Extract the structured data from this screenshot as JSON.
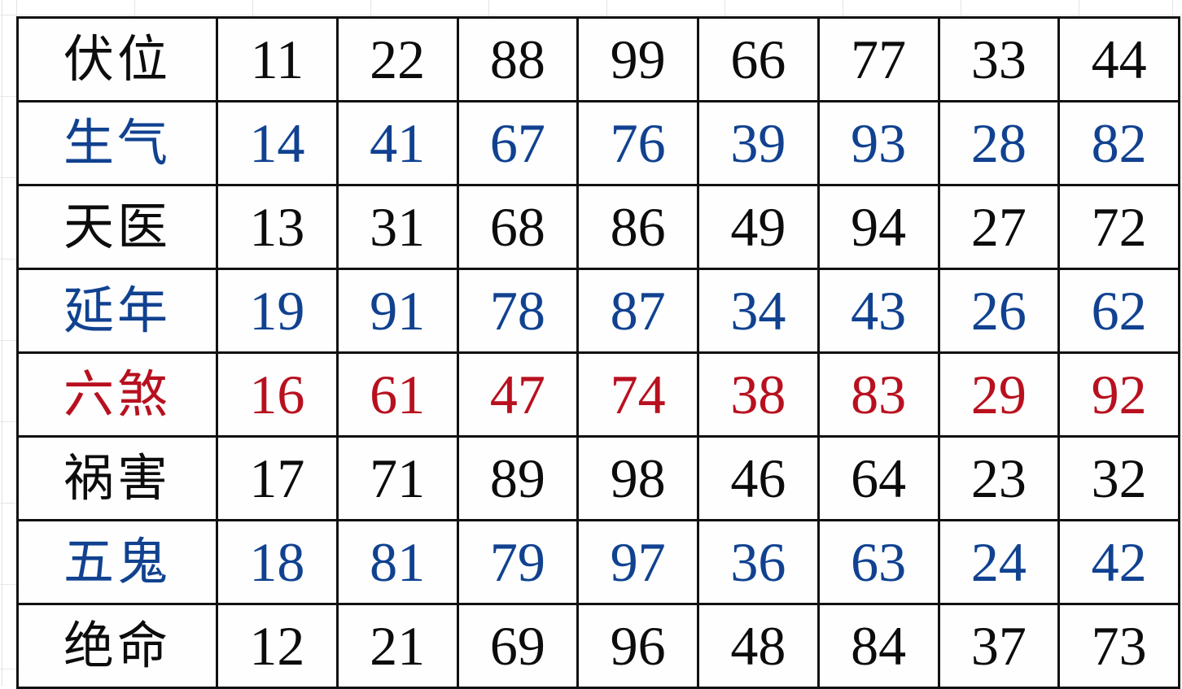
{
  "document": {
    "kind": "bagua-number-chart",
    "title": "伏位 生气 天医 延年 六煞 祸害 五鬼 绝命 数字表"
  },
  "colors": {
    "black": "#0c0c0c",
    "blue": "#11418f",
    "red": "#b8101f",
    "border": "#111111",
    "cell_background": "#fefefe",
    "page_background": "#ffffff",
    "background_gridline": "#e3e3e3"
  },
  "table": {
    "row_count": 8,
    "column_count": 9,
    "rows": [
      {
        "label": "伏位",
        "color": "black",
        "values": [
          "11",
          "22",
          "88",
          "99",
          "66",
          "77",
          "33",
          "44"
        ]
      },
      {
        "label": "生气",
        "color": "blue",
        "values": [
          "14",
          "41",
          "67",
          "76",
          "39",
          "93",
          "28",
          "82"
        ]
      },
      {
        "label": "天医",
        "color": "black",
        "values": [
          "13",
          "31",
          "68",
          "86",
          "49",
          "94",
          "27",
          "72"
        ]
      },
      {
        "label": "延年",
        "color": "blue",
        "values": [
          "19",
          "91",
          "78",
          "87",
          "34",
          "43",
          "26",
          "62"
        ]
      },
      {
        "label": "六煞",
        "color": "red",
        "values": [
          "16",
          "61",
          "47",
          "74",
          "38",
          "83",
          "29",
          "92"
        ]
      },
      {
        "label": "祸害",
        "color": "black",
        "values": [
          "17",
          "71",
          "89",
          "98",
          "46",
          "64",
          "23",
          "32"
        ]
      },
      {
        "label": "五鬼",
        "color": "blue",
        "values": [
          "18",
          "81",
          "79",
          "97",
          "36",
          "63",
          "24",
          "42"
        ]
      },
      {
        "label": "绝命",
        "color": "black",
        "values": [
          "12",
          "21",
          "69",
          "96",
          "48",
          "84",
          "37",
          "73"
        ]
      }
    ]
  }
}
